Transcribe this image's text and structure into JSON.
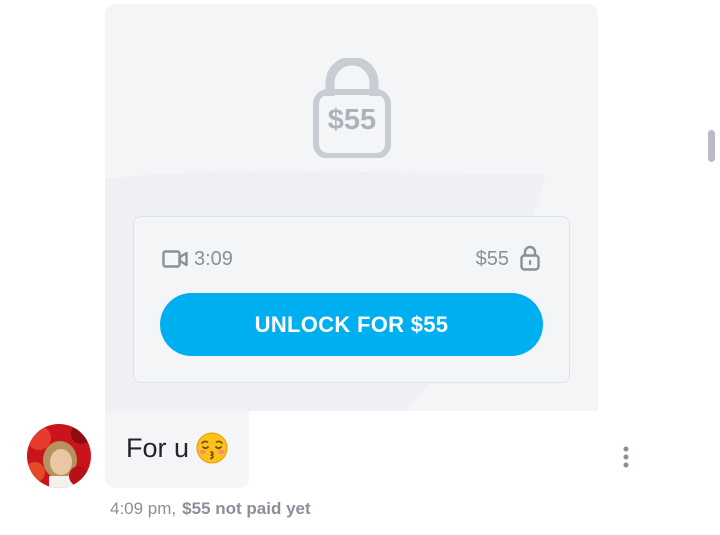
{
  "locked_media": {
    "lock_price": "$55",
    "duration": "3:09",
    "price": "$55",
    "unlock_label": "UNLOCK FOR $55",
    "video_icon": "video-camera-icon",
    "lock_icon": "padlock-icon"
  },
  "message": {
    "text": "For u",
    "emoji": "kissing-face-with-closed-eyes-emoji",
    "time": "4:09 pm,",
    "payment_status": "$55 not paid yet"
  },
  "sender": {
    "avatar": "user-avatar-photo"
  },
  "actions": {
    "more_icon": "more-vertical-icon"
  },
  "colors": {
    "accent": "#00aff0",
    "card_background": "#f4f5f7",
    "muted_text": "#8a9099",
    "avatar_red": "#c8141a"
  }
}
